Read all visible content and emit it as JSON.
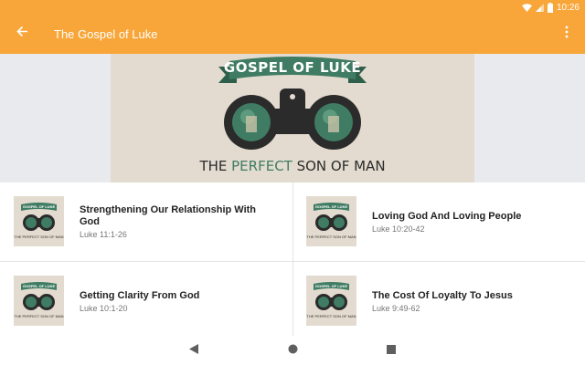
{
  "status_bar": {
    "time": "10:26",
    "icons": [
      "wifi-icon",
      "signal-icon",
      "battery-icon"
    ]
  },
  "app_bar": {
    "title": "The Gospel of Luke",
    "back_icon": "arrow-left-icon",
    "menu_icon": "more-vertical-icon"
  },
  "hero": {
    "banner": "GOSPEL OF LUKE",
    "tagline_before": "THE ",
    "tagline_highlight": "PERFECT",
    "tagline_after": " SON OF MAN"
  },
  "thumb": {
    "banner": "GOSPEL OF LUKE",
    "tagline": "THE PERFECT SON OF MAN"
  },
  "sermons": [
    {
      "title": "Strengthening Our Relationship With God",
      "ref": "Luke 11:1-26"
    },
    {
      "title": "Loving God And Loving People",
      "ref": "Luke 10:20-42"
    },
    {
      "title": "Getting Clarity From God",
      "ref": "Luke 10:1-20"
    },
    {
      "title": "The Cost Of Loyalty To Jesus",
      "ref": "Luke 9:49-62"
    }
  ],
  "colors": {
    "accent": "#f8a639",
    "banner_green": "#3f7c63",
    "dark": "#2b2b2b"
  }
}
